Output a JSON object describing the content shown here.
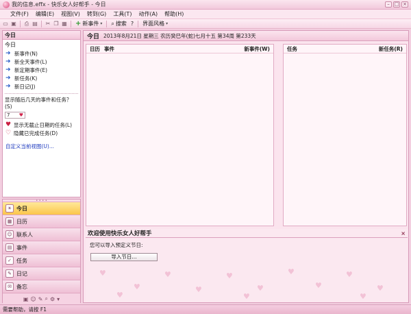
{
  "window": {
    "title": "我的信息.effx - 快乐女人好帮手 - 今日",
    "btn_min": "–",
    "btn_max": "□",
    "btn_close": "×"
  },
  "menu": [
    "文件(F)",
    "编辑(E)",
    "视图(V)",
    "转到(G)",
    "工具(T)",
    "动作(A)",
    "帮助(H)"
  ],
  "toolbar": {
    "new_event_label": "新事件",
    "search_label": "搜索",
    "help_label": "?",
    "skin_label": "界面风格"
  },
  "left_panel": {
    "header": "今日",
    "sub_title": "今日",
    "items": [
      "新事件(N)",
      "新全天事件(L)",
      "新定期事件(E)",
      "新任务(K)",
      "新日记(J)"
    ],
    "question": "显示随后几天的事件和任务？(S)",
    "days_value": "7",
    "options": [
      "显示无截止日期的任务(L)",
      "隐藏已完成任务(D)"
    ],
    "customize_link": "自定义当前视图(U)..."
  },
  "nav": {
    "items": [
      {
        "label": "今日",
        "icon": "today-icon"
      },
      {
        "label": "日历",
        "icon": "calendar-icon"
      },
      {
        "label": "联系人",
        "icon": "contacts-icon"
      },
      {
        "label": "事件",
        "icon": "events-icon"
      },
      {
        "label": "任务",
        "icon": "tasks-icon"
      },
      {
        "label": "日记",
        "icon": "diary-icon"
      },
      {
        "label": "备忘",
        "icon": "memo-icon"
      }
    ],
    "active_index": 0
  },
  "main": {
    "header_title": "今日",
    "header_date": "2013年8月21日 星期三  农历癸巳年(蛇)七月十五   第34周 第233天",
    "events_pane": {
      "col1": "日历",
      "col2": "事件",
      "new_link": "新事件(W)"
    },
    "tasks_pane": {
      "col1": "任务",
      "new_link": "新任务(R)"
    }
  },
  "welcome": {
    "title": "欢迎使用快乐女人好帮手",
    "close": "×",
    "text": "您可以导入预定义节日:",
    "import_button": "导入节日..."
  },
  "status": {
    "text": "需要帮助，请按 F1"
  },
  "colors": {
    "accent": "#d9487c",
    "panel_pink": "#f3cfe0",
    "active_yellow": "#fbc54a",
    "link_blue": "#1f3bbf"
  }
}
